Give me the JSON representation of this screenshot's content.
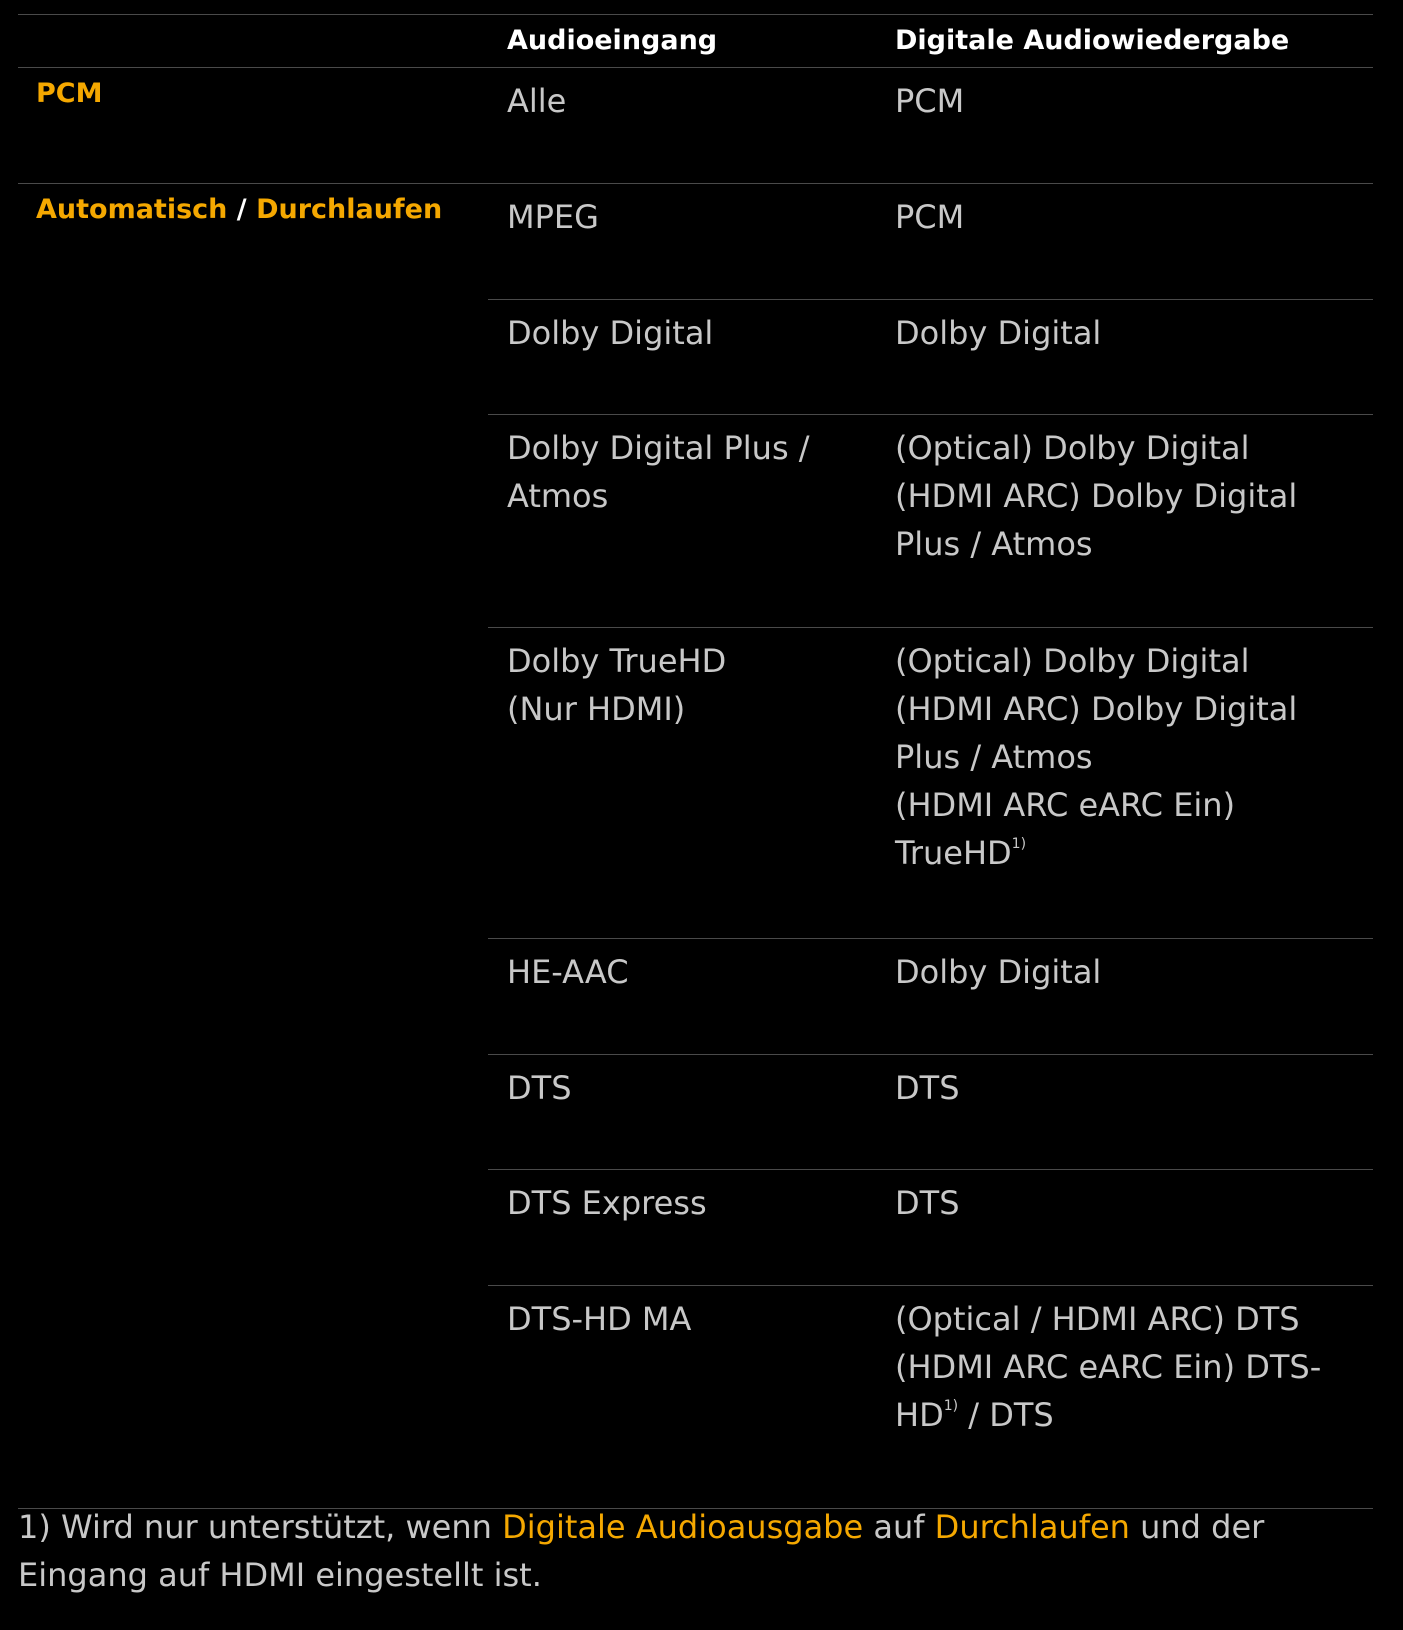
{
  "header": {
    "col1": "Audioeingang",
    "col2": "Digitale Audiowiedergabe"
  },
  "groups": {
    "pcm": {
      "label": "PCM",
      "rows": [
        {
          "input": [
            "Alle"
          ],
          "output": [
            "PCM"
          ]
        }
      ]
    },
    "auto": {
      "label_a": "Automatisch",
      "label_sep": " / ",
      "label_b": "Durchlaufen",
      "rows": [
        {
          "input": [
            "MPEG"
          ],
          "output": [
            "PCM"
          ]
        },
        {
          "input": [
            "Dolby Digital"
          ],
          "output": [
            "Dolby Digital"
          ]
        },
        {
          "input": [
            "Dolby Digital Plus /",
            "Atmos"
          ],
          "output": [
            "(Optical) Dolby Digital",
            "(HDMI ARC) Dolby Digital",
            "Plus / Atmos"
          ]
        },
        {
          "input": [
            "Dolby TrueHD",
            "(Nur HDMI)"
          ],
          "output": [
            "(Optical) Dolby Digital",
            "(HDMI ARC) Dolby Digital",
            "Plus / Atmos",
            "(HDMI ARC eARC Ein)",
            "TrueHD"
          ],
          "output_sup": "1)"
        },
        {
          "input": [
            "HE-AAC"
          ],
          "output": [
            "Dolby Digital"
          ]
        },
        {
          "input": [
            "DTS"
          ],
          "output": [
            "DTS"
          ]
        },
        {
          "input": [
            "DTS Express"
          ],
          "output": [
            "DTS"
          ]
        },
        {
          "input": [
            "DTS-HD MA"
          ],
          "output": [
            "(Optical / HDMI ARC) DTS",
            "(HDMI ARC eARC Ein) DTS-",
            "HD"
          ],
          "output_sup": "1)",
          "output_tail": " / DTS"
        }
      ]
    }
  },
  "footnote": {
    "p1": "1) Wird nur unterstützt, wenn ",
    "h1": "Digitale Audioausgabe",
    "p2": " auf ",
    "h2": "Durchlaufen",
    "p3": " und der",
    "line2": "Eingang auf HDMI eingestellt ist."
  }
}
